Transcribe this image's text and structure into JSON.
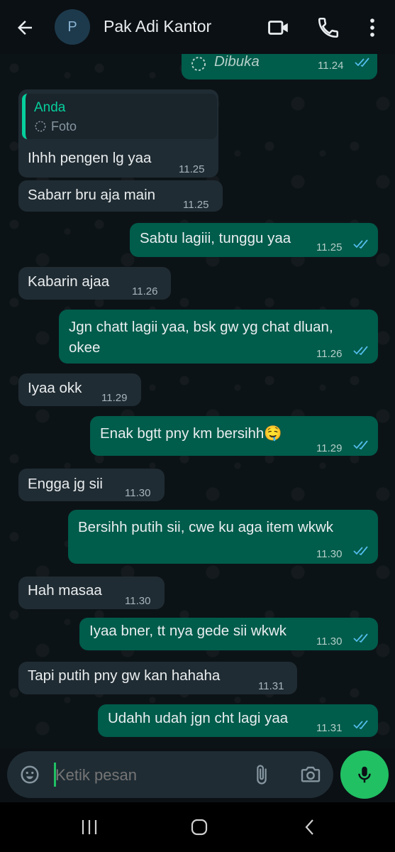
{
  "header": {
    "avatar_letter": "P",
    "contact_name": "Pak Adi Kantor",
    "icons": [
      "back-arrow-icon",
      "video-call-icon",
      "phone-icon",
      "more-vert-icon"
    ]
  },
  "messages": [
    {
      "dir": "out",
      "text": "Dibuka",
      "time": "11.24",
      "read": true,
      "kind": "view-once-opened"
    },
    {
      "dir": "in",
      "quote_author": "Anda",
      "quote_text": "Foto",
      "text": "Ihhh pengen lg yaa",
      "time": "11.25"
    },
    {
      "dir": "in",
      "text": "Sabarr bru aja main",
      "time": "11.25"
    },
    {
      "dir": "out",
      "text": "Sabtu lagiii, tunggu yaa",
      "time": "11.25",
      "read": true
    },
    {
      "dir": "in",
      "text": "Kabarin ajaa",
      "time": "11.26"
    },
    {
      "dir": "out",
      "text": "Jgn chatt lagii yaa, bsk gw yg chat dluan, okee",
      "time": "11.26",
      "read": true
    },
    {
      "dir": "in",
      "text": "Iyaa okk",
      "time": "11.29"
    },
    {
      "dir": "out",
      "text": "Enak bgtt pny km bersihh🤤",
      "time": "11.29",
      "read": true
    },
    {
      "dir": "in",
      "text": "Engga jg sii",
      "time": "11.30"
    },
    {
      "dir": "out",
      "text": "Bersihh putih sii, cwe ku aga item wkwk",
      "time": "11.30",
      "read": true
    },
    {
      "dir": "in",
      "text": "Hah masaa",
      "time": "11.30"
    },
    {
      "dir": "out",
      "text": "Iyaa bner, tt nya gede sii wkwk",
      "time": "11.30",
      "read": true
    },
    {
      "dir": "in",
      "text": "Tapi putih pny gw kan hahaha",
      "time": "11.31"
    },
    {
      "dir": "out",
      "text": "Udahh udah jgn cht lagi yaa",
      "time": "11.31",
      "read": true
    }
  ],
  "input": {
    "placeholder": "Ketik pesan"
  },
  "colors": {
    "incoming": "#202c33",
    "outgoing": "#005c4b",
    "accent": "#21c063",
    "tick": "#53bdeb"
  }
}
